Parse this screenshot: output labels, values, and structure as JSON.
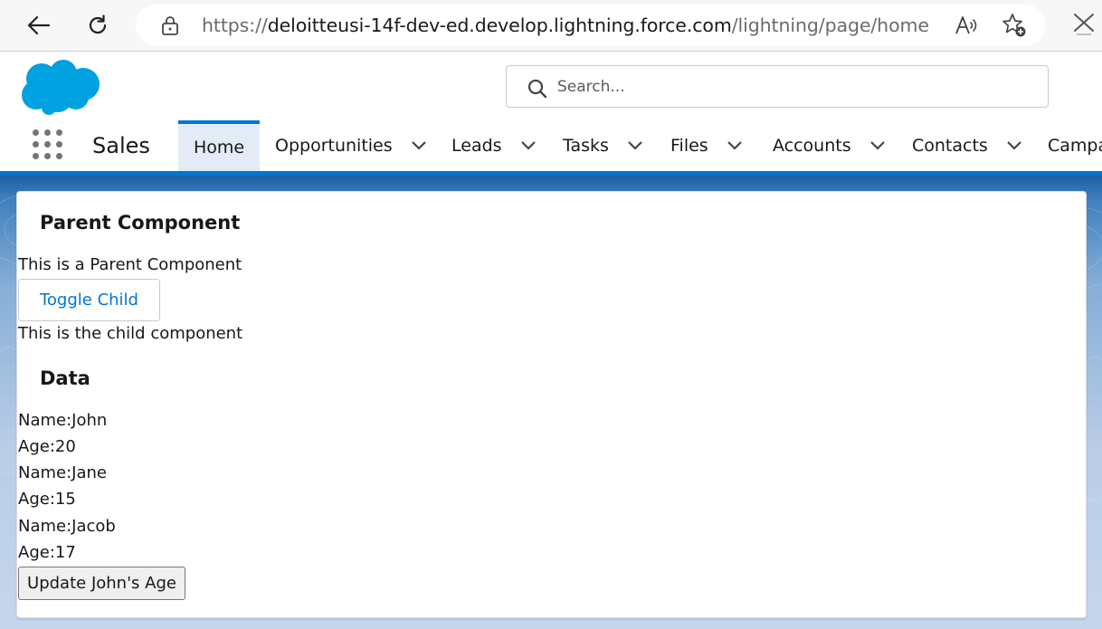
{
  "browser": {
    "url_scheme": "https://",
    "url_host": "deloitteusi-14f-dev-ed.develop.lightning.force.com",
    "url_path": "/lightning/page/home",
    "back_icon": "back-arrow-icon",
    "refresh_icon": "refresh-icon",
    "lock_icon": "lock-icon",
    "read_aloud_icon": "read-aloud-icon",
    "favorite_icon": "add-favorite-icon",
    "close_icon": "close-icon"
  },
  "header": {
    "logo": "salesforce-logo",
    "logo_color": "#00a1e0",
    "search": {
      "placeholder": "Search..."
    }
  },
  "nav": {
    "app_name": "Sales",
    "accent_color": "#0176d3",
    "tabs": [
      {
        "label": "Home",
        "active": true
      },
      {
        "label": "Opportunities"
      },
      {
        "label": "Leads"
      },
      {
        "label": "Tasks"
      },
      {
        "label": "Files"
      },
      {
        "label": "Accounts"
      },
      {
        "label": "Contacts"
      },
      {
        "label": "Campa"
      }
    ]
  },
  "card": {
    "title": "Parent Component",
    "parent_text": "This is a Parent Component",
    "toggle_button": "Toggle Child",
    "child_text": "This is the child component",
    "data_title": "Data",
    "records": [
      {
        "name": "Name:John",
        "age": "Age:20"
      },
      {
        "name": "Name:Jane",
        "age": "Age:15"
      },
      {
        "name": "Name:Jacob",
        "age": "Age:17"
      }
    ],
    "update_button": "Update John's Age"
  }
}
